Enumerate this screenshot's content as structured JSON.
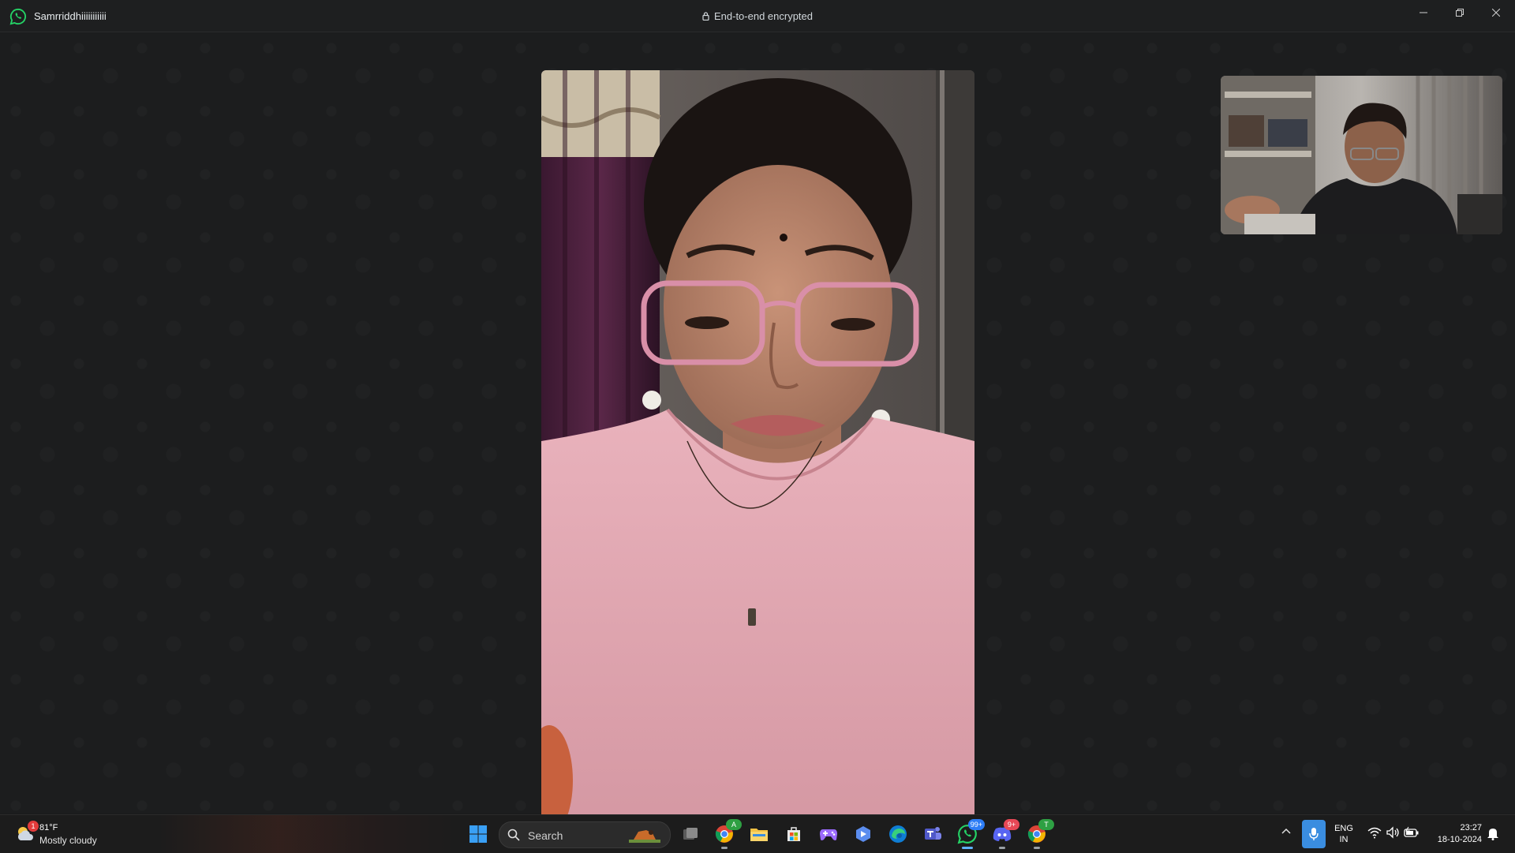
{
  "window": {
    "contact_name": "Samrriddhiiiiiiiiiii",
    "encryption_label": "End-to-end encrypted",
    "controls": {
      "minimize": "minimize",
      "restore": "restore",
      "close": "close"
    }
  },
  "call": {
    "remote_video": "remote-participant-video",
    "self_video": "self-preview-video"
  },
  "taskbar": {
    "weather": {
      "temperature": "81°F",
      "condition": "Mostly cloudy",
      "badge": "1"
    },
    "search_label": "Search",
    "apps": [
      {
        "name": "start",
        "icon": "windows-logo-icon"
      },
      {
        "name": "task-view",
        "icon": "task-view-icon"
      },
      {
        "name": "chrome-profile",
        "icon": "chrome-icon",
        "badge": "A"
      },
      {
        "name": "file-explorer",
        "icon": "folder-icon"
      },
      {
        "name": "microsoft-store",
        "icon": "store-icon"
      },
      {
        "name": "game-pass",
        "icon": "gamepad-icon"
      },
      {
        "name": "copilot",
        "icon": "copilot-icon"
      },
      {
        "name": "edge",
        "icon": "edge-icon"
      },
      {
        "name": "teams",
        "icon": "teams-icon"
      },
      {
        "name": "whatsapp",
        "icon": "whatsapp-icon",
        "badge": "99+"
      },
      {
        "name": "discord",
        "icon": "discord-icon",
        "badge": "9+"
      },
      {
        "name": "chrome",
        "icon": "chrome-icon",
        "badge": "T"
      }
    ],
    "tray": {
      "language_line1": "ENG",
      "language_line2": "IN",
      "time": "23:27",
      "date": "18-10-2024"
    }
  },
  "colors": {
    "whatsapp_green": "#25d366",
    "accent_blue": "#3a8de0",
    "background": "#1c1d1e"
  }
}
